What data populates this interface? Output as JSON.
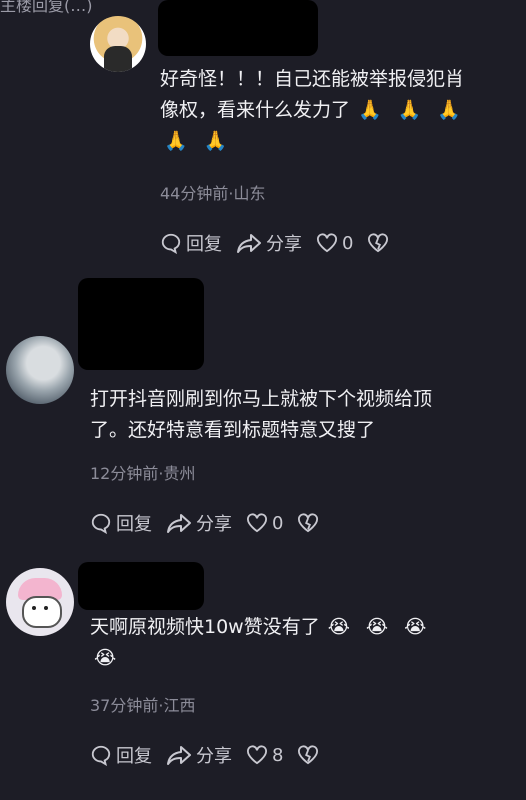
{
  "top_cut_text": "主楼回复(…)",
  "comments": [
    {
      "text_line1": "好奇怪！！！自己还能被举报侵犯肖",
      "text_line2": "像权，看来什么发力了",
      "emoji": "🙏",
      "meta": "44分钟前·山东",
      "reply_label": "回复",
      "share_label": "分享",
      "like_count": "0"
    },
    {
      "text_line1": "打开抖音刚刷到你马上就被下个视频给顶",
      "text_line2": "了。还好特意看到标题特意又搜了",
      "meta": "12分钟前·贵州",
      "reply_label": "回复",
      "share_label": "分享",
      "like_count": "0"
    },
    {
      "text_line1": "天啊原视频快10w赞没有了",
      "emoji": "😭",
      "meta": "37分钟前·江西",
      "reply_label": "回复",
      "share_label": "分享",
      "like_count": "8"
    }
  ],
  "colors": {
    "background": "#1d1d26",
    "meta": "#8c8c99",
    "redaction": "#000000"
  }
}
